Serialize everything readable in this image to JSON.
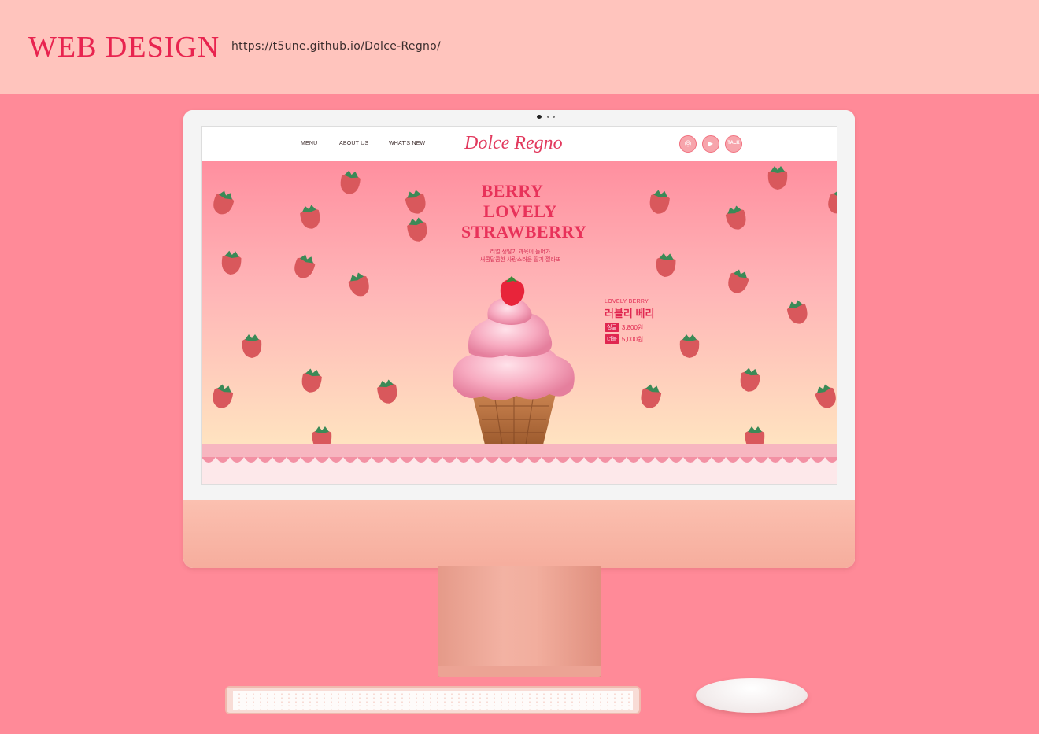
{
  "page": {
    "heading": "WEB DESIGN",
    "url": "https://t5une.github.io/Dolce-Regno/"
  },
  "site": {
    "nav": [
      "MENU",
      "ABOUT US",
      "WHAT'S NEW"
    ],
    "logo": "Dolce Regno",
    "social": [
      {
        "icon": "instagram-icon",
        "glyph": "◎"
      },
      {
        "icon": "youtube-icon",
        "glyph": "▶"
      },
      {
        "icon": "talk-icon",
        "glyph": "TALK"
      }
    ],
    "hero": {
      "line1": "BERRY",
      "line2": "LOVELY",
      "line3": "STRAWBERRY",
      "sub1": "리얼 생딸기 과육이 들어가",
      "sub2": "새콤달콤한 사랑스러운 딸기 젤라또"
    },
    "product": {
      "name_en": "LOVELY BERRY",
      "name_ko": "러블리 베리",
      "prices": [
        {
          "tag": "싱글",
          "price": "3,800원"
        },
        {
          "tag": "더블",
          "price": "5,000원"
        }
      ]
    }
  },
  "colors": {
    "background": "#ff8a98",
    "top_band": "#ffc4bd",
    "accent": "#e8244f"
  }
}
